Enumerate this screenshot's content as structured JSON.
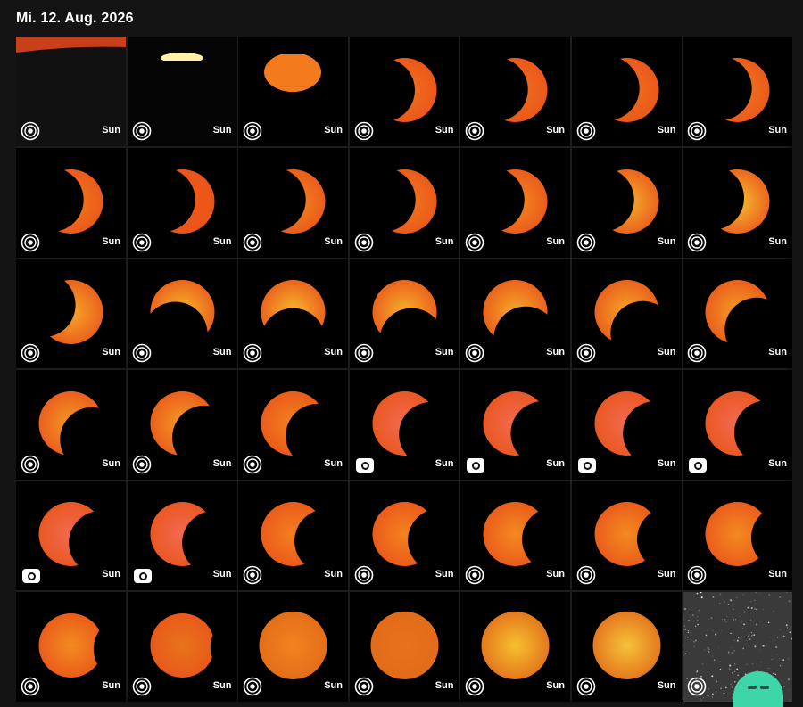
{
  "header": {
    "date": "Mi. 12. Aug. 2026"
  },
  "tile_label": "Sun",
  "colors": {
    "background": "#141414",
    "tile": "#000000",
    "accent": "#3cd6a8"
  },
  "tiles": [
    {
      "kind": "horizon"
    },
    {
      "kind": "setting"
    },
    {
      "kind": "partial",
      "sun": "#f47a1e",
      "offset": [
        -30,
        -14
      ],
      "clipTop": true
    },
    {
      "kind": "crescent",
      "sun": "#f4701c",
      "dx": -0.62,
      "dy": 0.0
    },
    {
      "kind": "crescent",
      "sun": "#f4701c",
      "dx": -0.55,
      "dy": -0.02
    },
    {
      "kind": "crescent",
      "sun": "#f4701c",
      "dx": -0.55,
      "dy": -0.05
    },
    {
      "kind": "crescent",
      "sun": "#f47a1e",
      "dx": -0.5,
      "dy": -0.05
    },
    {
      "kind": "crescent",
      "sun": "#f47a1e",
      "dx": -0.55,
      "dy": -0.05
    },
    {
      "kind": "crescent",
      "sun": "#f15a18",
      "dx": -0.55,
      "dy": -0.05
    },
    {
      "kind": "crescent",
      "sun": "#f48a20",
      "dx": -0.55,
      "dy": -0.05
    },
    {
      "kind": "crescent",
      "sun": "#f47a1e",
      "dx": -0.6,
      "dy": -0.05
    },
    {
      "kind": "crescent",
      "sun": "#f48a20",
      "dx": -0.65,
      "dy": -0.05
    },
    {
      "kind": "crescent",
      "sun": "#f7b22a",
      "dx": -0.7,
      "dy": -0.05
    },
    {
      "kind": "crescent",
      "sun": "#f7c030",
      "dx": -0.72,
      "dy": -0.1
    },
    {
      "kind": "crescent",
      "sun": "#f7a828",
      "dx": -0.78,
      "dy": -0.2
    },
    {
      "kind": "crescent",
      "sun": "#f7b82c",
      "dx": -0.2,
      "dy": 0.62
    },
    {
      "kind": "crescent",
      "sun": "#f7b82c",
      "dx": 0.0,
      "dy": 0.8
    },
    {
      "kind": "crescent",
      "sun": "#f7b02a",
      "dx": 0.2,
      "dy": 0.8
    },
    {
      "kind": "crescent",
      "sun": "#f7a828",
      "dx": 0.3,
      "dy": 0.75
    },
    {
      "kind": "crescent",
      "sun": "#f7a428",
      "dx": 0.45,
      "dy": 0.6
    },
    {
      "kind": "crescent",
      "sun": "#f49c26",
      "dx": 0.55,
      "dy": 0.5
    },
    {
      "kind": "crescent",
      "sun": "#f49a26",
      "dx": 0.6,
      "dy": 0.45
    },
    {
      "kind": "crescent",
      "sun": "#f49a26",
      "dx": 0.62,
      "dy": 0.4
    },
    {
      "kind": "crescent",
      "sun": "#f4821f",
      "dx": 0.7,
      "dy": 0.35
    },
    {
      "kind": "crescent",
      "sun": "#f26a50",
      "dx": 0.75,
      "dy": 0.3,
      "pill": true
    },
    {
      "kind": "crescent",
      "sun": "#f26a50",
      "dx": 0.78,
      "dy": 0.28,
      "pill": true
    },
    {
      "kind": "crescent",
      "sun": "#f26a50",
      "dx": 0.8,
      "dy": 0.28,
      "pill": true
    },
    {
      "kind": "crescent",
      "sun": "#f26a50",
      "dx": 0.82,
      "dy": 0.26,
      "pill": true
    },
    {
      "kind": "crescent",
      "sun": "#f26a50",
      "dx": 0.85,
      "dy": 0.25,
      "pill": true
    },
    {
      "kind": "crescent",
      "sun": "#f26a50",
      "dx": 0.9,
      "dy": 0.25,
      "pill": true
    },
    {
      "kind": "crescent",
      "sun": "#f4801f",
      "dx": 0.95,
      "dy": 0.2
    },
    {
      "kind": "crescent",
      "sun": "#f4821f",
      "dx": 1.0,
      "dy": 0.18
    },
    {
      "kind": "crescent",
      "sun": "#f48a20",
      "dx": 1.1,
      "dy": 0.15
    },
    {
      "kind": "crescent",
      "sun": "#f48a20",
      "dx": 1.2,
      "dy": 0.15
    },
    {
      "kind": "crescent",
      "sun": "#f48a20",
      "dx": 1.3,
      "dy": 0.1
    },
    {
      "kind": "crescent",
      "sun": "#f48a20",
      "dx": 1.55,
      "dy": 0.1
    },
    {
      "kind": "crescent",
      "sun": "#e8741c",
      "dx": 1.7,
      "dy": 0.05
    },
    {
      "kind": "full",
      "sun": "#f4821f"
    },
    {
      "kind": "full",
      "sun": "#e8721c"
    },
    {
      "kind": "full",
      "sun": "#f7c030"
    },
    {
      "kind": "full",
      "sun": "#f7c23a"
    },
    {
      "kind": "stars",
      "noLabel": true
    }
  ]
}
